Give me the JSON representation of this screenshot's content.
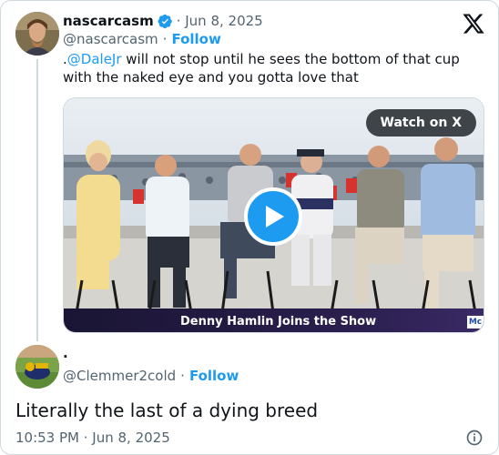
{
  "parent_tweet": {
    "display_name": "nascarcasm",
    "verified": true,
    "date": "· Jun 8, 2025",
    "handle": "@nascarcasm",
    "follow_label": "Follow",
    "text_prefix": ".",
    "mention": "@DaleJr",
    "text_line1_rest": " will not stop until he sees the bottom of that cup",
    "text_line2": "with the naked eye and you gotta love that",
    "video": {
      "watch_label": "Watch on X",
      "lower_third": "Denny Hamlin Joins the Show",
      "network_logo": "Mc"
    }
  },
  "reply_tweet": {
    "display_name": ".",
    "handle": "@Clemmer2cold",
    "follow_label": "Follow",
    "text": "Literally the last of a dying breed",
    "timestamp": "10:53 PM · Jun 8, 2025"
  },
  "icons": {
    "logo": "x-logo-icon",
    "verified": "verified-badge-icon",
    "play": "play-icon",
    "info": "info-icon"
  },
  "colors": {
    "accent": "#1d9bf0",
    "text": "#0f1419",
    "muted": "#536471",
    "border": "#cfd9de"
  }
}
